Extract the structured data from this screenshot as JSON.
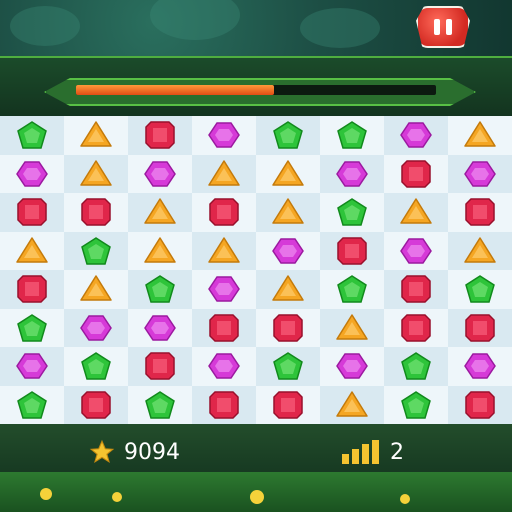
{
  "header": {
    "progress_fraction": 0.55
  },
  "footer": {
    "score": "9094",
    "moves": "2"
  },
  "colors": {
    "green": "#2ec43a",
    "orange": "#f5a623",
    "red": "#e0264a",
    "purple": "#d63ad8",
    "pause": "#d32a22"
  },
  "board": {
    "rows": [
      [
        "green",
        "orange",
        "red",
        "purple",
        "green",
        "green",
        "purple",
        "orange"
      ],
      [
        "purple",
        "orange",
        "purple",
        "orange",
        "orange",
        "purple",
        "red",
        "purple"
      ],
      [
        "red",
        "red",
        "orange",
        "red",
        "orange",
        "green",
        "orange",
        "red"
      ],
      [
        "orange",
        "green",
        "orange",
        "orange",
        "purple",
        "red",
        "purple",
        "orange"
      ],
      [
        "red",
        "orange",
        "green",
        "purple",
        "orange",
        "green",
        "red",
        "green"
      ],
      [
        "green",
        "purple",
        "purple",
        "red",
        "red",
        "orange",
        "red",
        "red"
      ],
      [
        "purple",
        "green",
        "red",
        "purple",
        "green",
        "purple",
        "green",
        "purple"
      ],
      [
        "green",
        "red",
        "green",
        "red",
        "red",
        "orange",
        "green",
        "red"
      ]
    ]
  }
}
